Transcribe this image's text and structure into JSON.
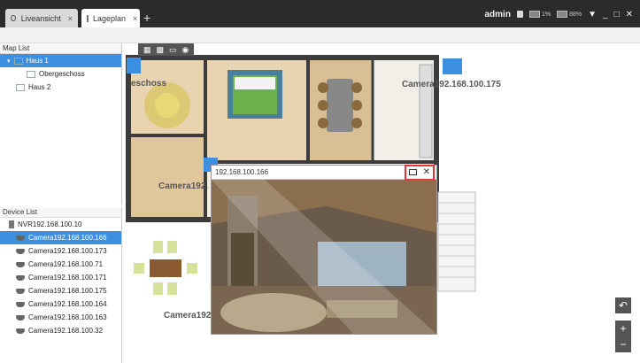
{
  "tabs": [
    {
      "label": "Liveansicht",
      "close": "×"
    },
    {
      "label": "Lageplan",
      "close": "×"
    }
  ],
  "add_tab": "+",
  "user": {
    "name": "admin"
  },
  "meters": [
    {
      "value": "1%"
    },
    {
      "value": "88%"
    }
  ],
  "map_list": {
    "title": "Map List",
    "items": [
      {
        "label": "Haus 1",
        "selected": true
      },
      {
        "label": "Obergeschoss"
      },
      {
        "label": "Haus 2"
      }
    ]
  },
  "device_list": {
    "title": "Device List",
    "items": [
      {
        "label": "NVR192.168.100.10",
        "type": "nvr"
      },
      {
        "label": "Camera192.168.100.166",
        "type": "camera",
        "selected": true
      },
      {
        "label": "Camera192.168.100.173",
        "type": "camera"
      },
      {
        "label": "Camera192.168.100.71",
        "type": "camera"
      },
      {
        "label": "Camera192.168.100.171",
        "type": "camera"
      },
      {
        "label": "Camera192.168.100.175",
        "type": "camera"
      },
      {
        "label": "Camera192.168.100.164",
        "type": "camera"
      },
      {
        "label": "Camera192.168.100.163",
        "type": "camera"
      },
      {
        "label": "Camera192.168.100.32",
        "type": "camera"
      }
    ]
  },
  "map": {
    "labels": [
      "eschoss",
      "Camera192.168.100.175",
      "Camera192.",
      "Camera192"
    ]
  },
  "popup": {
    "title": "192.168.100.166"
  },
  "colors": {
    "accent": "#3d8fe0",
    "highlight": "#e3343a",
    "topbar": "#2b2b2b"
  }
}
